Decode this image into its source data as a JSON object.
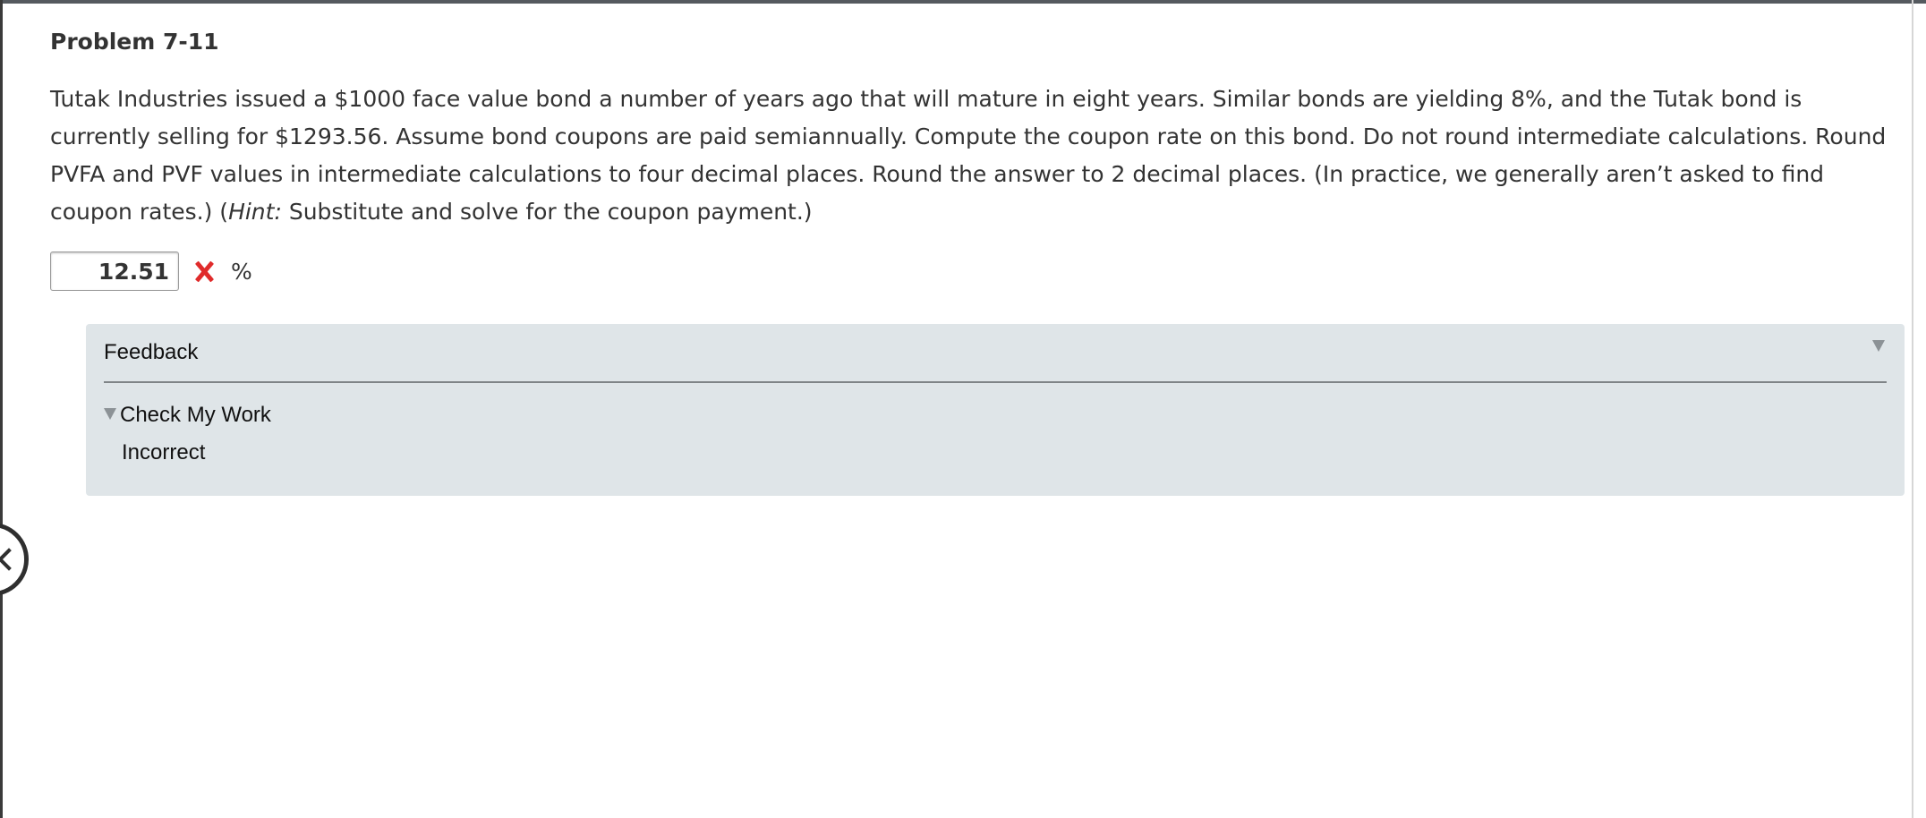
{
  "problem": {
    "title": "Problem 7-11",
    "text_main": "Tutak Industries issued a $1000 face value bond a number of years ago that will mature in eight years. Similar bonds are yielding 8%, and the Tutak bond is currently selling for $1293.56. Assume bond coupons are paid semiannually. Compute the coupon rate on this bond. Do not round intermediate calculations. Round PVFA and PVF values in intermediate calculations to four decimal places. Round the answer to 2 decimal places. (In practice, we generally aren’t asked to find coupon rates.) (",
    "hint_label": "Hint:",
    "text_end": " Substitute and solve for the coupon payment.)"
  },
  "answer": {
    "value": "12.51",
    "status_icon": "red-x-icon",
    "unit": "%"
  },
  "feedback": {
    "heading": "Feedback",
    "check_label": "Check My Work",
    "result": "Incorrect"
  },
  "colors": {
    "panel_background": "#dfe5e8",
    "incorrect": "#e02b2b",
    "text": "#333333"
  }
}
